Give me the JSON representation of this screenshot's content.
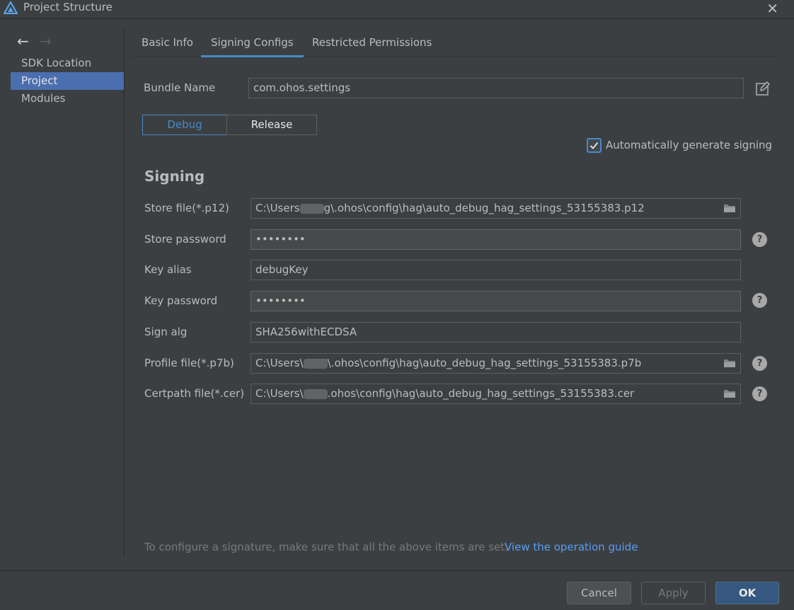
{
  "window": {
    "title": "Project Structure",
    "close_glyph": "✕",
    "colors": {
      "accent": "#4a88c7",
      "selection": "#4b6eaf",
      "link": "#589df6",
      "ok_button": "#365880"
    }
  },
  "sidebar": {
    "back_glyph": "←",
    "forward_glyph": "→",
    "items": [
      {
        "label": "SDK Location",
        "active": false
      },
      {
        "label": "Project",
        "active": true
      },
      {
        "label": "Modules",
        "active": false
      }
    ]
  },
  "tabs": [
    {
      "label": "Basic Info",
      "active": false
    },
    {
      "label": "Signing Configs",
      "active": true
    },
    {
      "label": "Restricted Permissions",
      "active": false
    }
  ],
  "bundle": {
    "label": "Bundle Name",
    "value": "com.ohos.settings",
    "icon": "edit-icon"
  },
  "build_type": {
    "debug": "Debug",
    "release": "Release",
    "selected": "Debug"
  },
  "auto_sign": {
    "label": "Automatically generate signing",
    "checked": true
  },
  "signing": {
    "title": "Signing",
    "fields": {
      "store_file": {
        "label": "Store file(*.p12)",
        "value_prefix": "C:\\Users",
        "value_suffix": "g\\.ohos\\config\\hag\\auto_debug_hag_settings_53155383.p12"
      },
      "store_password": {
        "label": "Store password",
        "value": "••••••••"
      },
      "key_alias": {
        "label": "Key alias",
        "value": "debugKey"
      },
      "key_password": {
        "label": "Key password",
        "value": "••••••••"
      },
      "sign_alg": {
        "label": "Sign alg",
        "value": "SHA256withECDSA"
      },
      "profile_file": {
        "label": "Profile file(*.p7b)",
        "value_prefix": "C:\\Users\\",
        "value_suffix": "\\.ohos\\config\\hag\\auto_debug_hag_settings_53155383.p7b"
      },
      "certpath_file": {
        "label": "Certpath file(*.cer)",
        "value_prefix": "C:\\Users\\",
        "value_suffix": ".ohos\\config\\hag\\auto_debug_hag_settings_53155383.cer"
      }
    },
    "help_glyph": "?"
  },
  "hint": {
    "text": "To configure a signature, make sure that all the above items are set.",
    "link": "View the operation guide"
  },
  "buttons": {
    "cancel": "Cancel",
    "apply": "Apply",
    "ok": "OK"
  }
}
